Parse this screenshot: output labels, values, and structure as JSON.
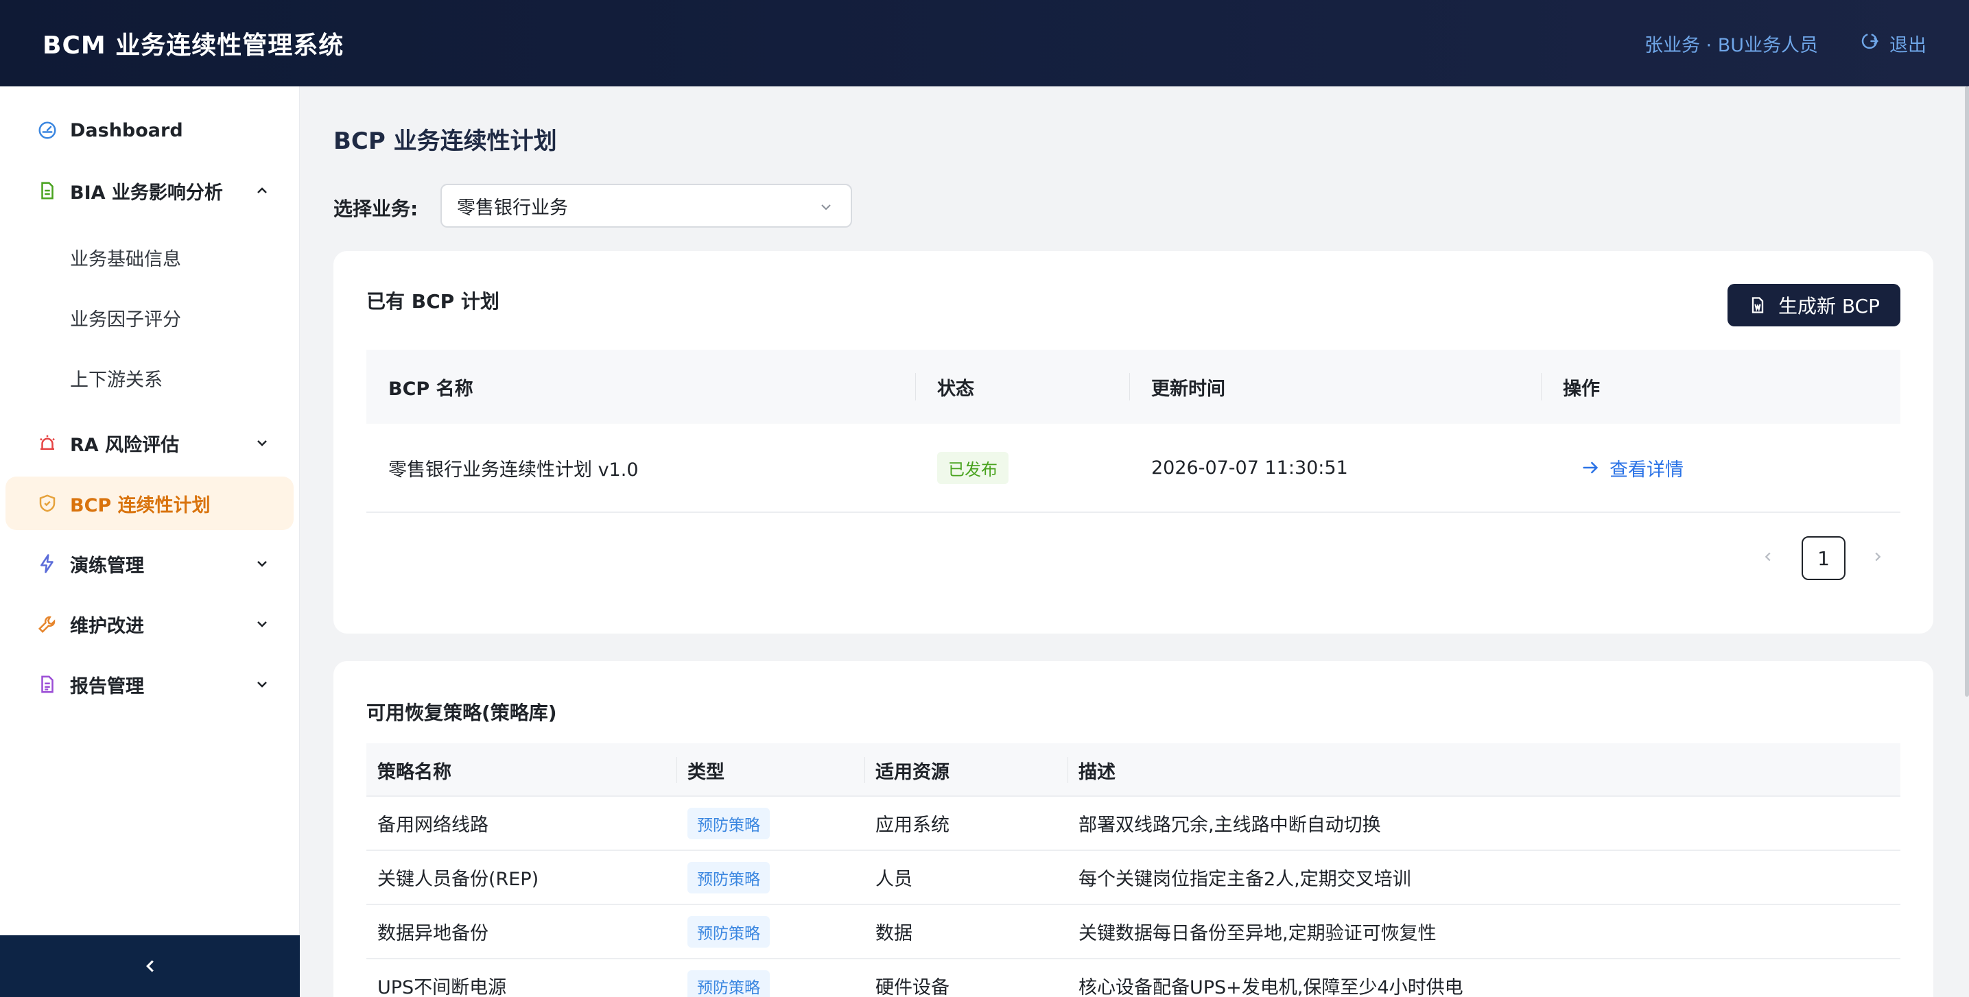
{
  "header": {
    "title": "BCM 业务连续性管理系统",
    "user": "张业务 · BU业务人员",
    "logout_label": "退出"
  },
  "sidebar": {
    "items": [
      {
        "label": "Dashboard",
        "icon": "dashboard-icon"
      },
      {
        "label": "BIA 业务影响分析",
        "icon": "document-icon",
        "expanded": true,
        "children": [
          "业务基础信息",
          "业务因子评分",
          "上下游关系"
        ]
      },
      {
        "label": "RA 风险评估",
        "icon": "alarm-icon"
      },
      {
        "label": "BCP 连续性计划",
        "icon": "shield-icon",
        "active": true
      },
      {
        "label": "演练管理",
        "icon": "lightning-icon"
      },
      {
        "label": "维护改进",
        "icon": "wrench-icon"
      },
      {
        "label": "报告管理",
        "icon": "report-icon"
      }
    ]
  },
  "main": {
    "page_title": "BCP 业务连续性计划",
    "select_label": "选择业务:",
    "selected_business": "零售银行业务"
  },
  "bcp_card": {
    "title": "已有 BCP 计划",
    "generate_button": "生成新 BCP",
    "columns": [
      "BCP 名称",
      "状态",
      "更新时间",
      "操作"
    ],
    "rows": [
      {
        "name": "零售银行业务连续性计划 v1.0",
        "status": "已发布",
        "updated": "2026-07-07 11:30:51",
        "action": "查看详情"
      }
    ],
    "pagination": {
      "current": "1"
    }
  },
  "strategy_card": {
    "title": "可用恢复策略(策略库)",
    "columns": [
      "策略名称",
      "类型",
      "适用资源",
      "描述"
    ],
    "rows": [
      {
        "name": "备用网络线路",
        "type": "预防策略",
        "resource": "应用系统",
        "desc": "部署双线路冗余,主线路中断自动切换"
      },
      {
        "name": "关键人员备份(REP)",
        "type": "预防策略",
        "resource": "人员",
        "desc": "每个关键岗位指定主备2人,定期交叉培训"
      },
      {
        "name": "数据异地备份",
        "type": "预防策略",
        "resource": "数据",
        "desc": "关键数据每日备份至异地,定期验证可恢复性"
      },
      {
        "name": "UPS不间断电源",
        "type": "预防策略",
        "resource": "硬件设备",
        "desc": "核心设备配备UPS+发电机,保障至少4小时供电"
      }
    ]
  },
  "colors": {
    "header_bg": "#15203f",
    "active_bg": "#fff4e6",
    "active_text": "#d9730d",
    "link": "#2b73e6",
    "status_green": "#49a31f",
    "tag_blue": "#3a86e0",
    "button_bg": "#17213d"
  }
}
